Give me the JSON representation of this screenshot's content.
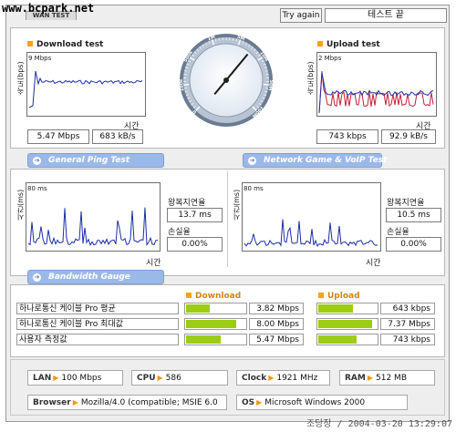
{
  "watermark": "www.bcpark.net",
  "tab": "WAN TEST",
  "try_again": "Try again",
  "status": "테스트 끝",
  "download": {
    "title": "Download test",
    "ylabel": "속도(bps)",
    "scale": "9 Mbps",
    "xlabel": "시간",
    "speed": "5.47 Mbps",
    "rate": "683 kB/s"
  },
  "upload": {
    "title": "Upload test",
    "ylabel": "속도(bps)",
    "scale": "2 Mbps",
    "xlabel": "시간",
    "speed": "743 kbps",
    "rate": "92.9 kB/s"
  },
  "gauge": {
    "labels": [
      "0",
      "100k",
      "500k",
      "1M",
      "5M",
      "10M",
      "50M",
      "100M"
    ],
    "needle_fraction": 0.5
  },
  "ping": {
    "general_title": "General Ping Test",
    "game_title": "Network Game & VoIP Test",
    "left": {
      "ylabel": "시간(ms)",
      "scale": "80 ms",
      "xlabel": "시간",
      "rtt_label": "왕복지연율",
      "rtt": "13.7 ms",
      "loss_label": "손실율",
      "loss": "0.00%"
    },
    "right": {
      "ylabel": "시간(ms)",
      "scale": "80 ms",
      "xlabel": "시간",
      "rtt_label": "왕복지연율",
      "rtt": "10.5 ms",
      "loss_label": "손실율",
      "loss": "0.00%"
    }
  },
  "bandwidth": {
    "title": "Bandwidth Gauge",
    "download_header": "Download",
    "upload_header": "Upload",
    "rows": [
      {
        "label": "하나로통신 케이블 Pro 평균",
        "down": "3.82 Mbps",
        "down_frac": 0.4,
        "up": "643 kbps",
        "up_frac": 0.58
      },
      {
        "label": "하나로통신 케이블 Pro 최대값",
        "down": "8.00 Mbps",
        "down_frac": 0.84,
        "up": "7.37 Mbps",
        "up_frac": 0.9
      },
      {
        "label": "사용자 측정값",
        "down": "5.47 Mbps",
        "down_frac": 0.58,
        "up": "743 kbps",
        "up_frac": 0.65
      }
    ]
  },
  "info": {
    "lan_label": "LAN",
    "lan": "100 Mbps",
    "cpu_label": "CPU",
    "cpu": "586",
    "clock_label": "Clock",
    "clock": "1921 MHz",
    "ram_label": "RAM",
    "ram": "512 MB",
    "browser_label": "Browser",
    "browser": "Mozilla/4.0 (compatible; MSIE 6.0",
    "os_label": "OS",
    "os": "Microsoft Windows 2000"
  },
  "footer": "조당장 / 2004-03-20 13:29:07",
  "colors": {
    "accent": "#f7a21b",
    "pill": "#9bb9e8",
    "bar": "#9ccc14",
    "line_blue": "#1d2fa6",
    "line_red": "#c81e3a"
  }
}
